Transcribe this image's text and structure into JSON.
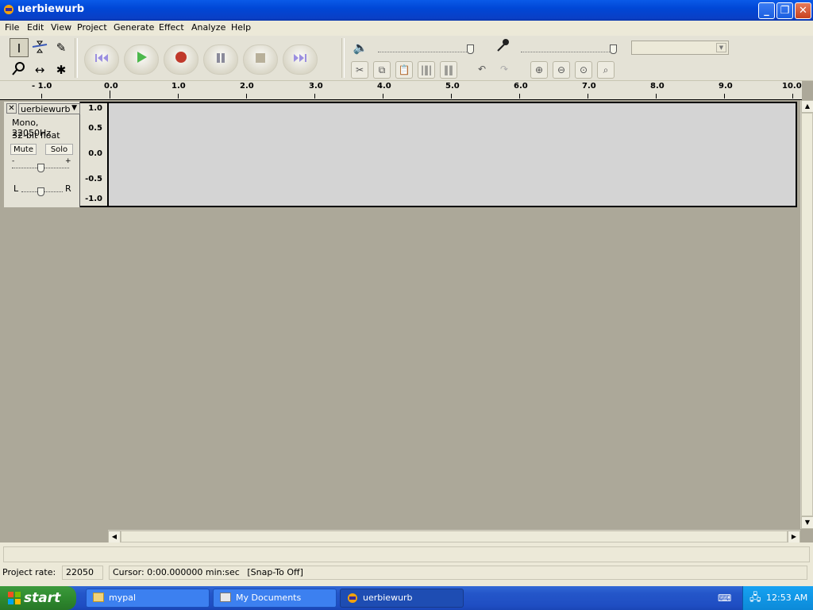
{
  "window": {
    "title": "uerbiewurb",
    "minimize": "_",
    "maximize": "❐",
    "close": "✕"
  },
  "menu": [
    "File",
    "Edit",
    "View",
    "Project",
    "Generate",
    "Effect",
    "Analyze",
    "Help"
  ],
  "ruler": {
    "labels": [
      "- 1.0",
      "0.0",
      "1.0",
      "2.0",
      "3.0",
      "4.0",
      "5.0",
      "6.0",
      "7.0",
      "8.0",
      "9.0",
      "10.0"
    ]
  },
  "track": {
    "name": "uerbiewurb",
    "format": "Mono, 22050Hz",
    "bitdepth": "32-bit float",
    "mute_label": "Mute",
    "solo_label": "Solo",
    "gain_minus": "-",
    "gain_plus": "+",
    "pan_left": "L",
    "pan_right": "R",
    "vruler": [
      "1.0",
      "0.5",
      "0.0",
      "-0.5",
      "-1.0"
    ]
  },
  "statusbar": {
    "project_rate_label": "Project rate:",
    "project_rate_value": "22050",
    "cursor_text": "Cursor: 0:00.000000 min:sec",
    "snap_text": "[Snap-To Off]"
  },
  "taskbar": {
    "start_label": "start",
    "buttons": [
      {
        "label": "mypal"
      },
      {
        "label": "My Documents"
      },
      {
        "label": "uerbiewurb"
      }
    ],
    "clock": "12:53 AM"
  },
  "colors": {
    "title_blue": "#0047d6",
    "play_green": "#4cb84c",
    "record_red": "#c0392b",
    "taskbar_blue": "#2456c9"
  }
}
